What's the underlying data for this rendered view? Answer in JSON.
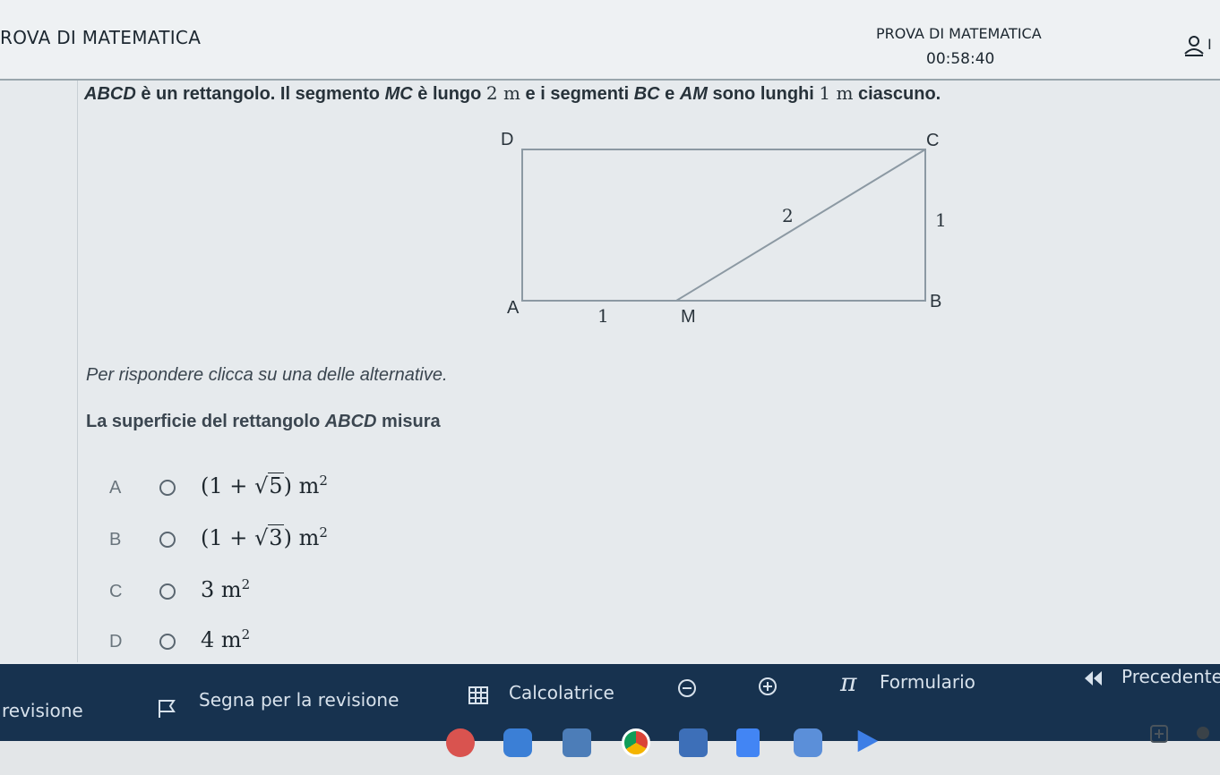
{
  "header": {
    "title_left": "ROVA DI MATEMATICA",
    "title_center": "PROVA DI MATEMATICA",
    "timer": "00:58:40",
    "user_cut": "I"
  },
  "question": {
    "text_1": "ABCD",
    "text_2": " è un rettangolo. Il segmento ",
    "text_3": "MC",
    "text_4": " è lungo ",
    "text_5": "2 m",
    "text_6": " e i segmenti ",
    "text_7": "BC",
    "text_8": " e ",
    "text_9": "AM",
    "text_10": " sono lunghi ",
    "text_11": "1 m",
    "text_12": " ciascuno."
  },
  "figure": {
    "label_D": "D",
    "label_C": "C",
    "label_A": "A",
    "label_B": "B",
    "label_M": "M",
    "label_MC": "2",
    "label_BC": "1",
    "label_AM": "1"
  },
  "instruction": "Per rispondere clicca su una delle alternative.",
  "prompt": {
    "text_1": "La superficie del rettangolo ",
    "text_2": "ABCD",
    "text_3": " misura"
  },
  "options": [
    {
      "letter": "A",
      "pre": "(1 + √",
      "rad": "5",
      "post": ") m",
      "exp": "2"
    },
    {
      "letter": "B",
      "pre": "(1 + √",
      "rad": "3",
      "post": ") m",
      "exp": "2"
    },
    {
      "letter": "C",
      "pre": "3 m",
      "rad": "",
      "post": "",
      "exp": "2"
    },
    {
      "letter": "D",
      "pre": "4 m",
      "rad": "",
      "post": "",
      "exp": "2"
    }
  ],
  "toolbar": {
    "revisione": "revisione",
    "segna": "Segna per la revisione",
    "calcolatrice": "Calcolatrice",
    "formulario": "Formulario",
    "precedente": "Precedente"
  },
  "colors": {
    "toolbar_bg": "#17324f",
    "header_bg": "#eef1f3"
  }
}
